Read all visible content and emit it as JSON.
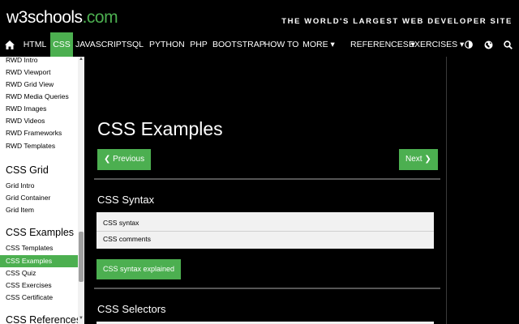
{
  "header": {
    "logo_main": "w3schools",
    "logo_suffix": ".com",
    "tagline": "THE WORLD'S LARGEST WEB DEVELOPER SITE"
  },
  "nav": {
    "home_icon": "home-icon",
    "items": [
      "HTML",
      "CSS",
      "JAVASCRIPT",
      "SQL",
      "PYTHON",
      "PHP",
      "BOOTSTRAP",
      "HOW TO",
      "MORE ▾"
    ],
    "active": "CSS",
    "right_items": [
      "REFERENCES ▾",
      "EXERCISES ▾"
    ],
    "icons": [
      "contrast-icon",
      "globe-icon",
      "search-icon"
    ]
  },
  "sidebar": {
    "rwd_links": [
      "RWD Intro",
      "RWD Viewport",
      "RWD Grid View",
      "RWD Media Queries",
      "RWD Images",
      "RWD Videos",
      "RWD Frameworks",
      "RWD Templates"
    ],
    "grid_heading": "CSS Grid",
    "grid_links": [
      "Grid Intro",
      "Grid Container",
      "Grid Item"
    ],
    "examples_heading": "CSS Examples",
    "examples_links": [
      "CSS Templates",
      "CSS Examples",
      "CSS Quiz",
      "CSS Exercises",
      "CSS Certificate"
    ],
    "examples_active": "CSS Examples",
    "references_heading": "CSS References"
  },
  "main": {
    "title": "CSS Examples",
    "prev_label": "❮ Previous",
    "next_label": "Next ❯",
    "sections": [
      {
        "title": "CSS Syntax",
        "items": [
          "CSS syntax",
          "CSS comments"
        ],
        "button": "CSS syntax explained"
      },
      {
        "title": "CSS Selectors"
      }
    ]
  },
  "colors": {
    "accent": "#4caf50",
    "background": "#000000",
    "sidebar": "#ffffff",
    "panel": "#f1f1f1"
  }
}
